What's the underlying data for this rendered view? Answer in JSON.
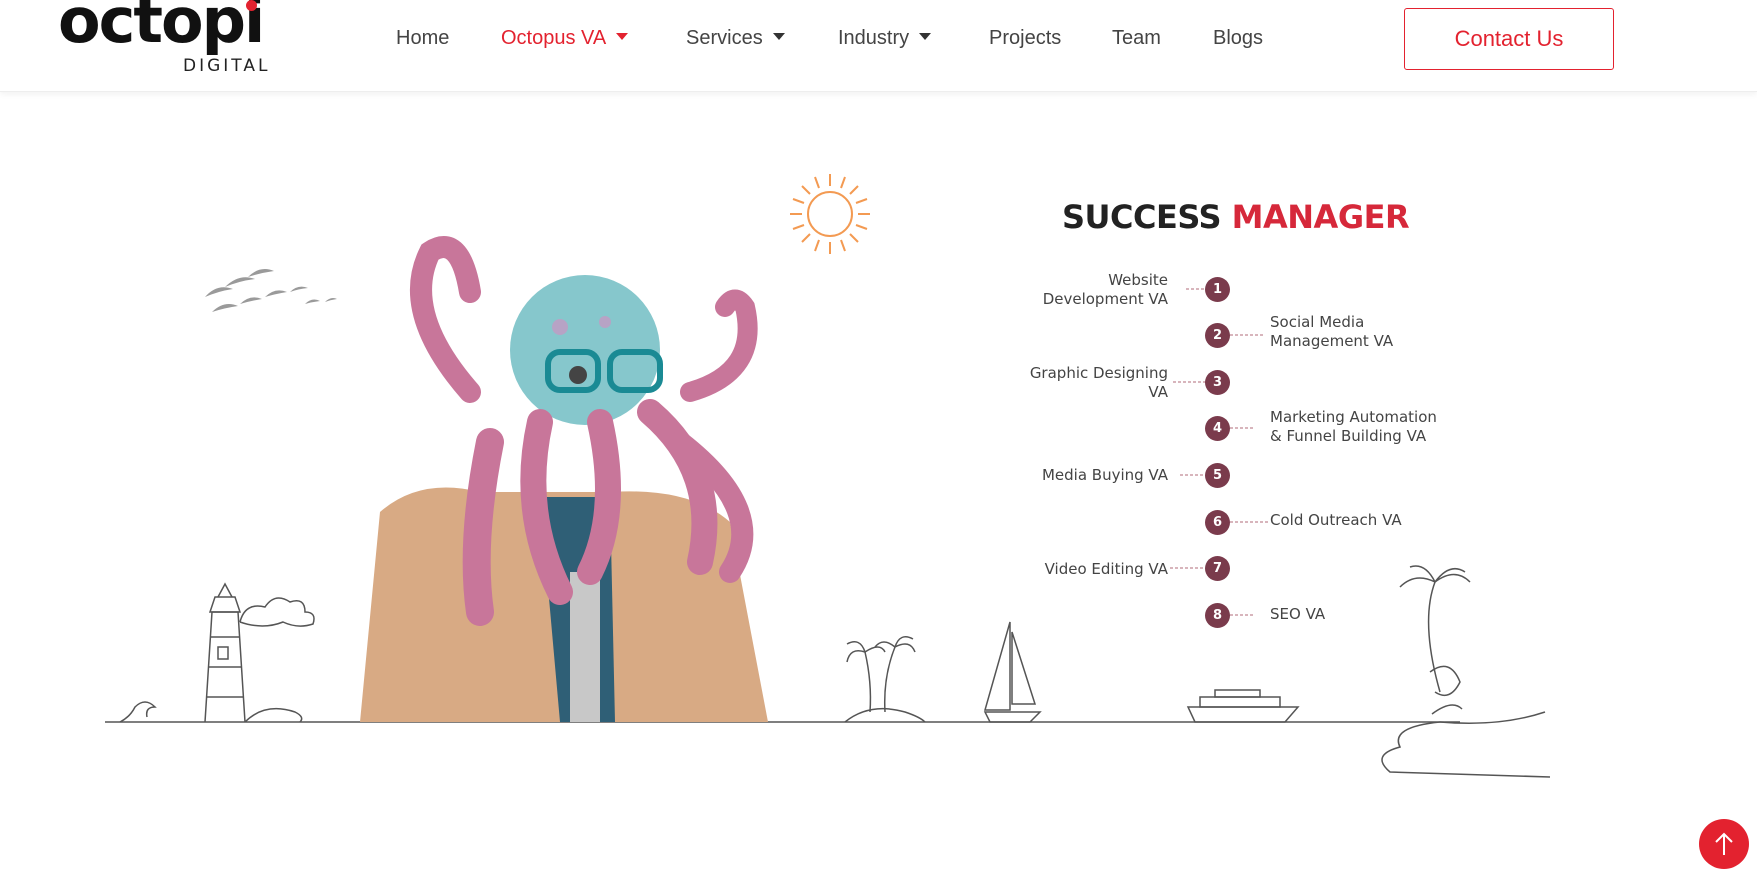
{
  "brand": {
    "logo_text": "octopi",
    "logo_subtext": "DIGITAL",
    "accent_color": "#e3222f"
  },
  "nav": {
    "items": [
      {
        "label": "Home",
        "has_dropdown": false,
        "active": false
      },
      {
        "label": "Octopus VA",
        "has_dropdown": true,
        "active": true
      },
      {
        "label": "Services",
        "has_dropdown": true,
        "active": false
      },
      {
        "label": "Industry",
        "has_dropdown": true,
        "active": false
      },
      {
        "label": "Projects",
        "has_dropdown": false,
        "active": false
      },
      {
        "label": "Team",
        "has_dropdown": false,
        "active": false
      },
      {
        "label": "Blogs",
        "has_dropdown": false,
        "active": false
      }
    ],
    "contact_label": "Contact Us"
  },
  "infographic": {
    "title_dark": "SUCCESS",
    "title_red": "MANAGER",
    "steps": [
      {
        "num": "1",
        "label": "Website Development VA",
        "side": "left"
      },
      {
        "num": "2",
        "label": "Social Media Management VA",
        "side": "right"
      },
      {
        "num": "3",
        "label": "Graphic Designing VA",
        "side": "left"
      },
      {
        "num": "4",
        "label": "Marketing Automation & Funnel Building VA",
        "side": "right"
      },
      {
        "num": "5",
        "label": "Media Buying VA",
        "side": "left"
      },
      {
        "num": "6",
        "label": "Cold Outreach VA",
        "side": "right"
      },
      {
        "num": "7",
        "label": "Video Editing VA",
        "side": "left"
      },
      {
        "num": "8",
        "label": "SEO VA",
        "side": "right"
      }
    ],
    "step_color": "#7a3b4c"
  },
  "icons": {
    "dropdown": "chevron-down-icon",
    "scroll_top": "arrow-up-icon"
  }
}
